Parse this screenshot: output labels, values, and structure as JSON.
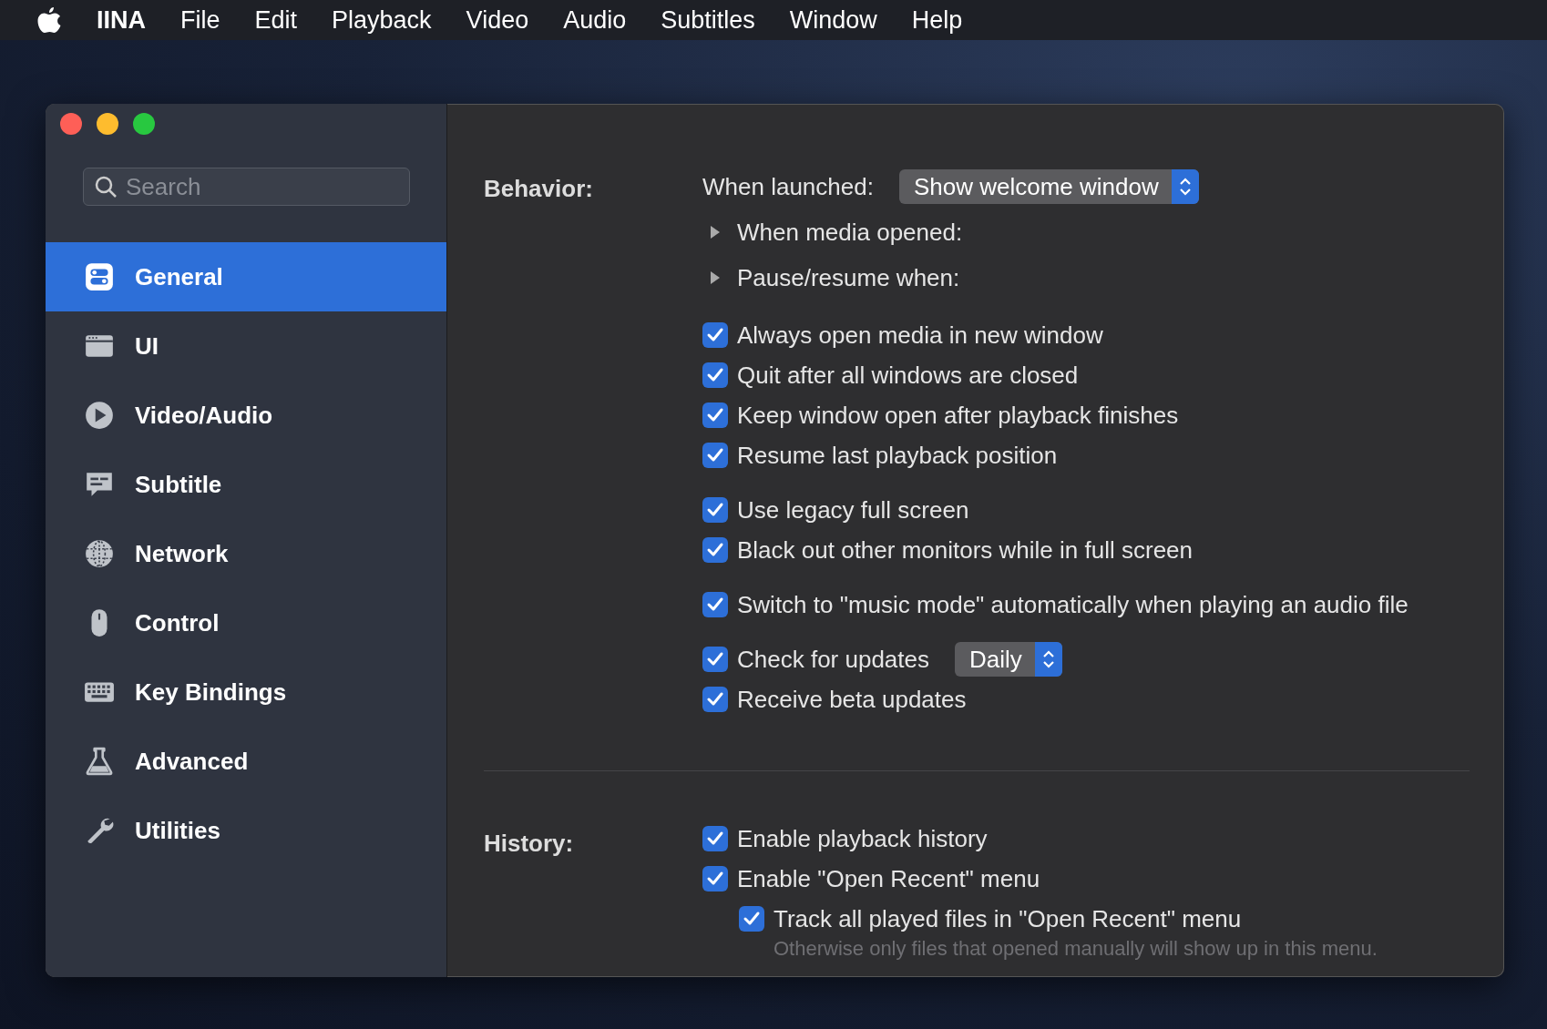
{
  "menu_bar": {
    "app_name": "IINA",
    "menus": [
      "File",
      "Edit",
      "Playback",
      "Video",
      "Audio",
      "Subtitles",
      "Window",
      "Help"
    ]
  },
  "sidebar": {
    "search": {
      "placeholder": "Search"
    },
    "items": [
      {
        "label": "General",
        "selected": true
      },
      {
        "label": "UI",
        "selected": false
      },
      {
        "label": "Video/Audio",
        "selected": false
      },
      {
        "label": "Subtitle",
        "selected": false
      },
      {
        "label": "Network",
        "selected": false
      },
      {
        "label": "Control",
        "selected": false
      },
      {
        "label": "Key Bindings",
        "selected": false
      },
      {
        "label": "Advanced",
        "selected": false
      },
      {
        "label": "Utilities",
        "selected": false
      }
    ]
  },
  "sections": [
    {
      "title": "Behavior:",
      "groups": [
        [
          {
            "kind": "popup",
            "label": "When launched:",
            "value": "Show welcome window"
          },
          {
            "kind": "disclosure",
            "label": "When media opened:",
            "expanded": false
          },
          {
            "kind": "disclosure",
            "label": "Pause/resume when:",
            "expanded": false
          }
        ],
        [
          {
            "kind": "checkbox",
            "label": "Always open media in new window",
            "checked": true
          },
          {
            "kind": "checkbox",
            "label": "Quit after all windows are closed",
            "checked": true
          },
          {
            "kind": "checkbox",
            "label": "Keep window open after playback finishes",
            "checked": true
          },
          {
            "kind": "checkbox",
            "label": "Resume last playback position",
            "checked": true
          }
        ],
        [
          {
            "kind": "checkbox",
            "label": "Use legacy full screen",
            "checked": true
          },
          {
            "kind": "checkbox",
            "label": "Black out other monitors while in full screen",
            "checked": true
          }
        ],
        [
          {
            "kind": "checkbox",
            "label": "Switch to \"music mode\" automatically when playing an audio file",
            "checked": true
          }
        ],
        [
          {
            "kind": "checkbox",
            "label": "Check for updates",
            "checked": true,
            "popup_value": "Daily"
          },
          {
            "kind": "checkbox",
            "label": "Receive beta updates",
            "checked": true
          }
        ]
      ]
    },
    {
      "title": "History:",
      "groups": [
        [
          {
            "kind": "checkbox",
            "label": "Enable playback history",
            "checked": true
          },
          {
            "kind": "checkbox",
            "label": "Enable \"Open Recent\" menu",
            "checked": true,
            "children": [
              {
                "kind": "checkbox",
                "label": "Track all played files in \"Open Recent\" menu",
                "checked": true,
                "note": "Otherwise only files that opened manually will show up in this menu."
              }
            ]
          }
        ]
      ]
    }
  ]
}
